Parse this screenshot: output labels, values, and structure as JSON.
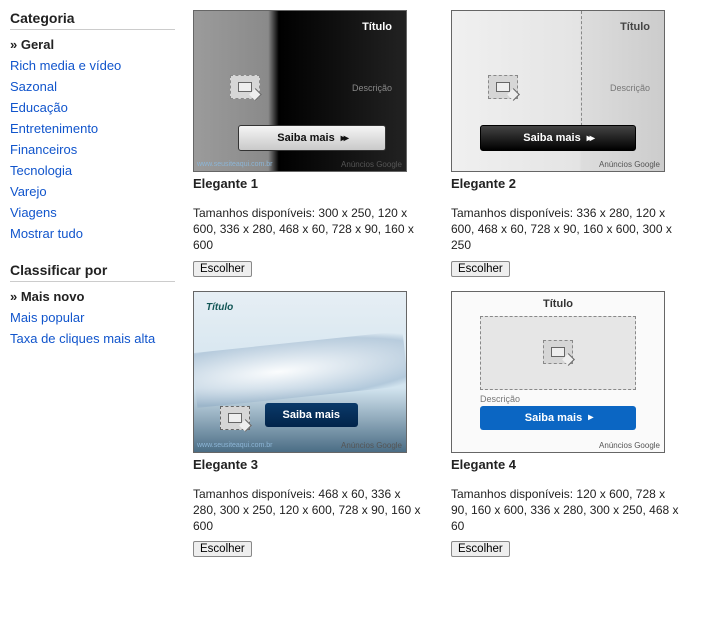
{
  "sidebar": {
    "category_heading": "Categoria",
    "selected_category": "» Geral",
    "categories": [
      "Rich media e vídeo",
      "Sazonal",
      "Educação",
      "Entretenimento",
      "Financeiros",
      "Tecnologia",
      "Varejo",
      "Viagens",
      "Mostrar tudo"
    ],
    "sort_heading": "Classificar por",
    "selected_sort": "» Mais novo",
    "sorts": [
      "Mais popular",
      "Taxa de cliques mais alta"
    ]
  },
  "preview": {
    "title_label": "Título",
    "desc_label": "Descrição",
    "cta_label": "Saiba mais",
    "brand_prefix": "Anúncios",
    "brand_name": "Google",
    "sample_url": "www.seusiteaqui.com.br"
  },
  "templates": [
    {
      "id": "t1",
      "name": "Elegante 1",
      "sizes_label": "Tamanhos disponíveis:",
      "sizes": "300 x 250, 120 x 600, 336 x 280, 468 x 60, 728 x 90, 160 x 600",
      "choose_label": "Escolher"
    },
    {
      "id": "t2",
      "name": "Elegante 2",
      "sizes_label": "Tamanhos disponíveis:",
      "sizes": "336 x 280, 120 x 600, 468 x 60, 728 x 90, 160 x 600, 300 x 250",
      "choose_label": "Escolher"
    },
    {
      "id": "t3",
      "name": "Elegante 3",
      "sizes_label": "Tamanhos disponíveis:",
      "sizes": "468 x 60, 336 x 280, 300 x 250, 120 x 600, 728 x 90, 160 x 600",
      "choose_label": "Escolher"
    },
    {
      "id": "t4",
      "name": "Elegante 4",
      "sizes_label": "Tamanhos disponíveis:",
      "sizes": "120 x 600, 728 x 90, 160 x 600, 336 x 280, 300 x 250, 468 x 60",
      "choose_label": "Escolher"
    }
  ]
}
